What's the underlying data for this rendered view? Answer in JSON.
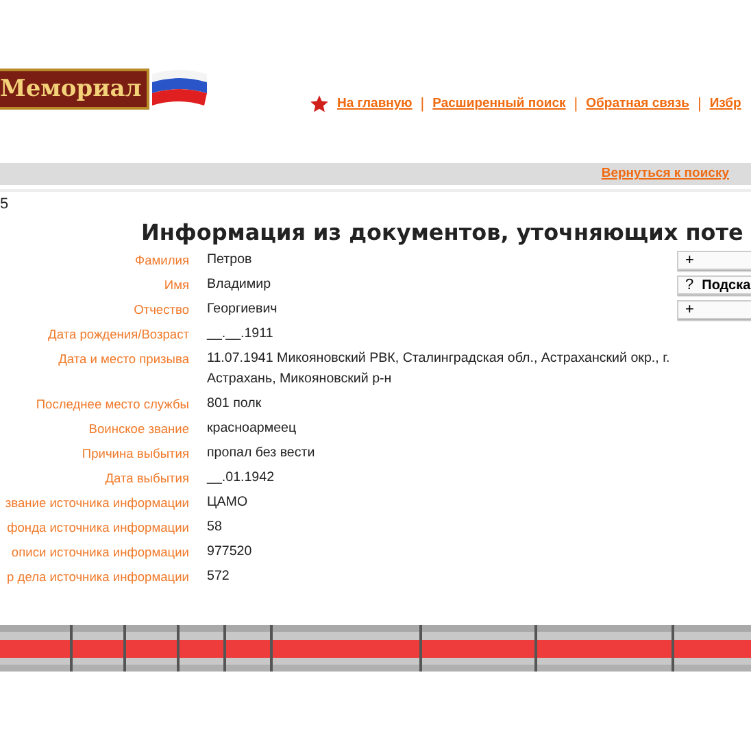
{
  "logo": {
    "text": "Мемориал"
  },
  "nav": [
    {
      "label": "На главную"
    },
    {
      "label": "Расширенный поиск"
    },
    {
      "label": "Обратная связь"
    },
    {
      "label": "Избр"
    }
  ],
  "nav_separator": "|",
  "back_link": "Вернуться к поиску",
  "page_marker": "5",
  "title": "Информация из документов, уточняющих поте",
  "fields": [
    {
      "label": "Фамилия",
      "value": "Петров"
    },
    {
      "label": "Имя",
      "value": "Владимир"
    },
    {
      "label": "Отчество",
      "value": "Георгиевич"
    },
    {
      "label": "Дата рождения/Возраст",
      "value": "__.__.1911"
    },
    {
      "label": "Дата и место призыва",
      "value": "11.07.1941 Микояновский РВК, Сталинградская обл., Астраханский окр., г. Астрахань, Микояновский р-н"
    },
    {
      "label": "Последнее место службы",
      "value": "801 полк"
    },
    {
      "label": "Воинское звание",
      "value": "красноармеец"
    },
    {
      "label": "Причина выбытия",
      "value": "пропал без вести"
    },
    {
      "label": "Дата выбытия",
      "value": "__.01.1942"
    },
    {
      "label": "звание источника информации",
      "value": "ЦАМО"
    },
    {
      "label": "фонда источника информации",
      "value": "58"
    },
    {
      "label": "описи источника информации",
      "value": "977520"
    },
    {
      "label": "р дела источника информации",
      "value": "572"
    }
  ],
  "side_buttons": [
    {
      "icon": "+"
    },
    {
      "icon": "?",
      "label": "Подска"
    },
    {
      "icon": "+"
    }
  ]
}
